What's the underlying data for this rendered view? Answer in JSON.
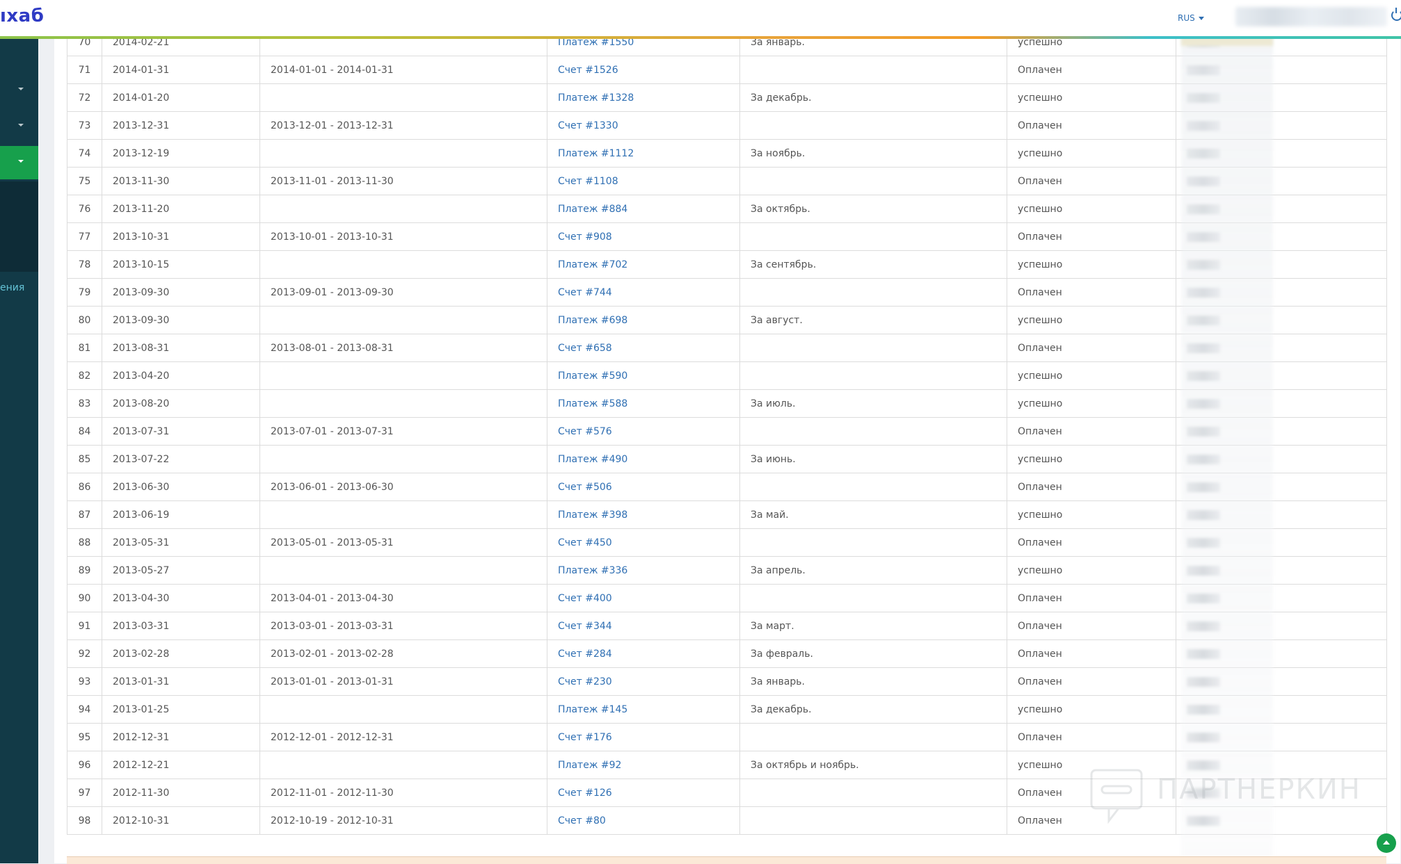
{
  "header": {
    "logo": "ıхаб",
    "language": "RUS"
  },
  "sidebar": {
    "partial_label": "ения"
  },
  "rows": [
    {
      "num": "70",
      "date": "2014-02-21",
      "period": "",
      "doc": "Платеж #1550",
      "comment": "За январь.",
      "status": "успешно"
    },
    {
      "num": "71",
      "date": "2014-01-31",
      "period": "2014-01-01 - 2014-01-31",
      "doc": "Счет #1526",
      "comment": "",
      "status": "Оплачен"
    },
    {
      "num": "72",
      "date": "2014-01-20",
      "period": "",
      "doc": "Платеж #1328",
      "comment": "За декабрь.",
      "status": "успешно"
    },
    {
      "num": "73",
      "date": "2013-12-31",
      "period": "2013-12-01 - 2013-12-31",
      "doc": "Счет #1330",
      "comment": "",
      "status": "Оплачен"
    },
    {
      "num": "74",
      "date": "2013-12-19",
      "period": "",
      "doc": "Платеж #1112",
      "comment": "За ноябрь.",
      "status": "успешно"
    },
    {
      "num": "75",
      "date": "2013-11-30",
      "period": "2013-11-01 - 2013-11-30",
      "doc": "Счет #1108",
      "comment": "",
      "status": "Оплачен"
    },
    {
      "num": "76",
      "date": "2013-11-20",
      "period": "",
      "doc": "Платеж #884",
      "comment": "За октябрь.",
      "status": "успешно"
    },
    {
      "num": "77",
      "date": "2013-10-31",
      "period": "2013-10-01 - 2013-10-31",
      "doc": "Счет #908",
      "comment": "",
      "status": "Оплачен"
    },
    {
      "num": "78",
      "date": "2013-10-15",
      "period": "",
      "doc": "Платеж #702",
      "comment": "За сентябрь.",
      "status": "успешно"
    },
    {
      "num": "79",
      "date": "2013-09-30",
      "period": "2013-09-01 - 2013-09-30",
      "doc": "Счет #744",
      "comment": "",
      "status": "Оплачен"
    },
    {
      "num": "80",
      "date": "2013-09-30",
      "period": "",
      "doc": "Платеж #698",
      "comment": "За август.",
      "status": "успешно"
    },
    {
      "num": "81",
      "date": "2013-08-31",
      "period": "2013-08-01 - 2013-08-31",
      "doc": "Счет #658",
      "comment": "",
      "status": "Оплачен"
    },
    {
      "num": "82",
      "date": "2013-04-20",
      "period": "",
      "doc": "Платеж #590",
      "comment": "",
      "status": "успешно"
    },
    {
      "num": "83",
      "date": "2013-08-20",
      "period": "",
      "doc": "Платеж #588",
      "comment": "За июль.",
      "status": "успешно"
    },
    {
      "num": "84",
      "date": "2013-07-31",
      "period": "2013-07-01 - 2013-07-31",
      "doc": "Счет #576",
      "comment": "",
      "status": "Оплачен"
    },
    {
      "num": "85",
      "date": "2013-07-22",
      "period": "",
      "doc": "Платеж #490",
      "comment": "За июнь.",
      "status": "успешно"
    },
    {
      "num": "86",
      "date": "2013-06-30",
      "period": "2013-06-01 - 2013-06-30",
      "doc": "Счет #506",
      "comment": "",
      "status": "Оплачен"
    },
    {
      "num": "87",
      "date": "2013-06-19",
      "period": "",
      "doc": "Платеж #398",
      "comment": "За май.",
      "status": "успешно"
    },
    {
      "num": "88",
      "date": "2013-05-31",
      "period": "2013-05-01 - 2013-05-31",
      "doc": "Счет #450",
      "comment": "",
      "status": "Оплачен"
    },
    {
      "num": "89",
      "date": "2013-05-27",
      "period": "",
      "doc": "Платеж #336",
      "comment": "За апрель.",
      "status": "успешно"
    },
    {
      "num": "90",
      "date": "2013-04-30",
      "period": "2013-04-01 - 2013-04-30",
      "doc": "Счет #400",
      "comment": "",
      "status": "Оплачен"
    },
    {
      "num": "91",
      "date": "2013-03-31",
      "period": "2013-03-01 - 2013-03-31",
      "doc": "Счет #344",
      "comment": "За март.",
      "status": "Оплачен"
    },
    {
      "num": "92",
      "date": "2013-02-28",
      "period": "2013-02-01 - 2013-02-28",
      "doc": "Счет #284",
      "comment": "За февраль.",
      "status": "Оплачен"
    },
    {
      "num": "93",
      "date": "2013-01-31",
      "period": "2013-01-01 - 2013-01-31",
      "doc": "Счет #230",
      "comment": "За январь.",
      "status": "Оплачен"
    },
    {
      "num": "94",
      "date": "2013-01-25",
      "period": "",
      "doc": "Платеж #145",
      "comment": "За декабрь.",
      "status": "успешно"
    },
    {
      "num": "95",
      "date": "2012-12-31",
      "period": "2012-12-01 - 2012-12-31",
      "doc": "Счет #176",
      "comment": "",
      "status": "Оплачен"
    },
    {
      "num": "96",
      "date": "2012-12-21",
      "period": "",
      "doc": "Платеж #92",
      "comment": "За октябрь и ноябрь.",
      "status": "успешно"
    },
    {
      "num": "97",
      "date": "2012-11-30",
      "period": "2012-11-01 - 2012-11-30",
      "doc": "Счет #126",
      "comment": "",
      "status": "Оплачен"
    },
    {
      "num": "98",
      "date": "2012-10-31",
      "period": "2012-10-19 - 2012-10-31",
      "doc": "Счет #80",
      "comment": "",
      "status": "Оплачен"
    }
  ],
  "watermark": "ПАРТНЕРКИН"
}
